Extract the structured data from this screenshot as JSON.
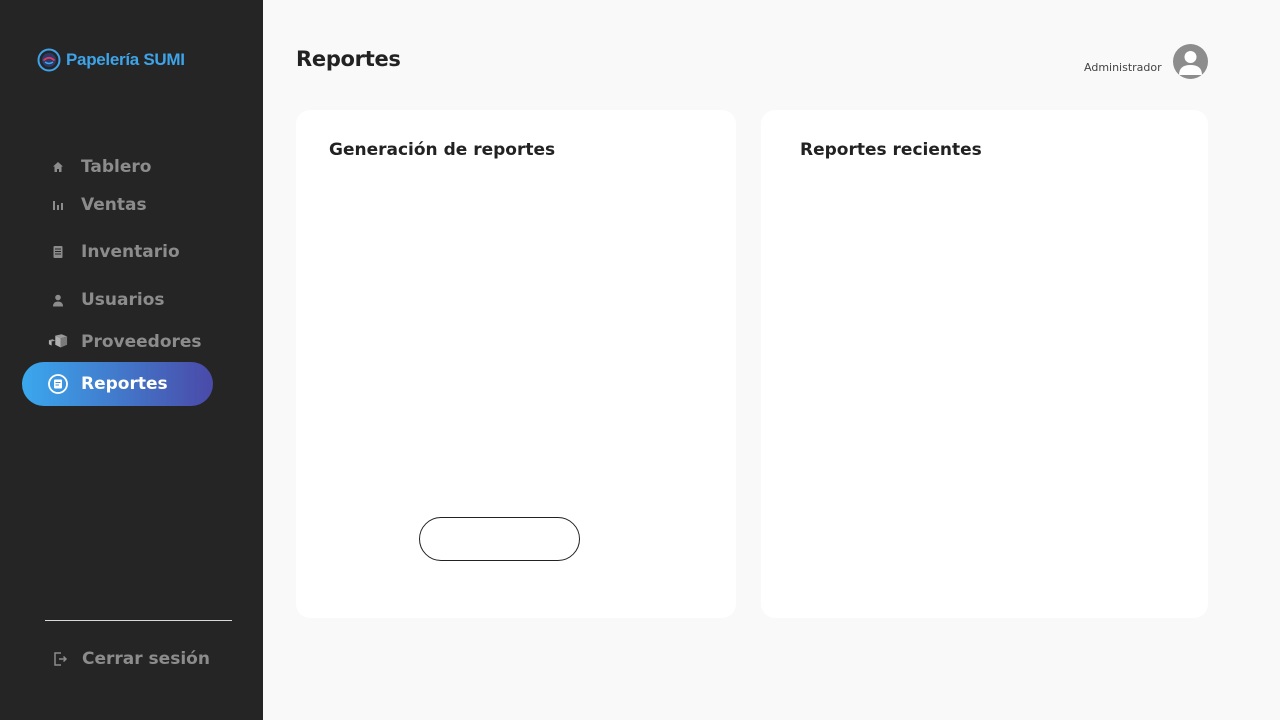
{
  "app": {
    "name": "Papelería SUMI",
    "brand_color": "#3ea3e8"
  },
  "sidebar": {
    "items": [
      {
        "label": "Tablero",
        "icon": "home-icon"
      },
      {
        "label": "Ventas",
        "icon": "bar-chart-icon"
      },
      {
        "label": "Inventario",
        "icon": "document-icon"
      },
      {
        "label": "Usuarios",
        "icon": "user-icon"
      },
      {
        "label": "Proveedores",
        "icon": "boxes-icon"
      },
      {
        "label": "Reportes",
        "icon": "report-icon",
        "active": true
      }
    ],
    "logout": {
      "label": "Cerrar sesión",
      "icon": "logout-icon"
    },
    "background": "#252525",
    "active_gradient": [
      "#3aa8ee",
      "#4a4aa8"
    ]
  },
  "header": {
    "title": "Reportes",
    "user_role": "Administrador"
  },
  "main": {
    "left_card": {
      "title": "Generación de reportes",
      "button_label": ""
    },
    "right_card": {
      "title": "Reportes recientes"
    }
  }
}
